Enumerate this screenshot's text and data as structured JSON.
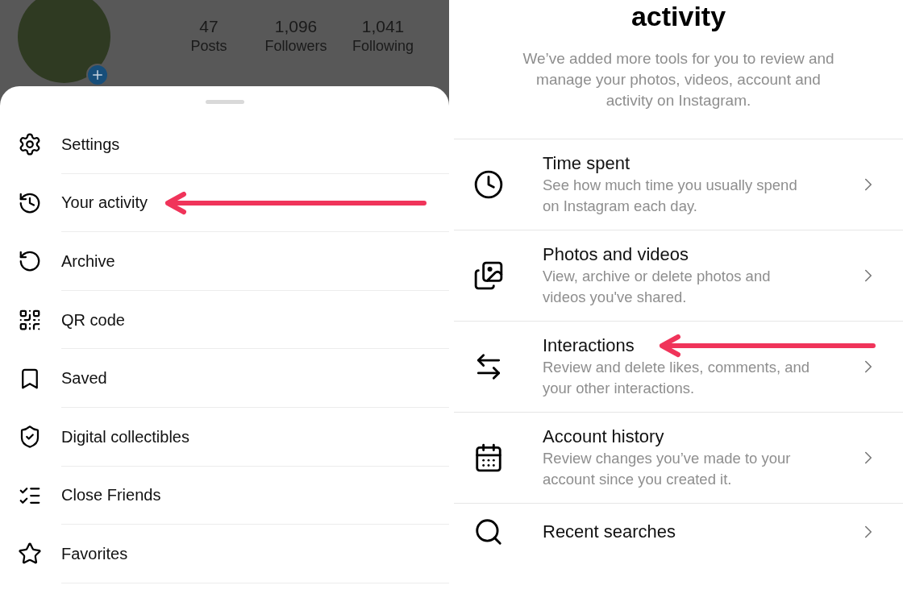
{
  "profile": {
    "stats": [
      {
        "value": "47",
        "label": "Posts"
      },
      {
        "value": "1,096",
        "label": "Followers"
      },
      {
        "value": "1,041",
        "label": "Following"
      }
    ]
  },
  "menu": {
    "items": [
      {
        "label": "Settings",
        "marked": false
      },
      {
        "label": "Your activity",
        "marked": true
      },
      {
        "label": "Archive",
        "marked": false
      },
      {
        "label": "QR code",
        "marked": false
      },
      {
        "label": "Saved",
        "marked": false
      },
      {
        "label": "Digital collectibles",
        "marked": false
      },
      {
        "label": "Close Friends",
        "marked": false
      },
      {
        "label": "Favorites",
        "marked": false
      }
    ]
  },
  "activity": {
    "title": "activity",
    "description": "We’ve added more tools for you to review and manage your photos, videos, account and activity on Instagram.",
    "items": [
      {
        "title": "Time spent",
        "subtitle": "See how much time you usually spend on Instagram each day.",
        "marked": false
      },
      {
        "title": "Photos and videos",
        "subtitle": "View, archive or delete photos and videos you've shared.",
        "marked": false
      },
      {
        "title": "Interactions",
        "subtitle": "Review and delete likes, comments, and your other interactions.",
        "marked": true
      },
      {
        "title": "Account history",
        "subtitle": "Review changes you’ve made to your account since you created it.",
        "marked": false
      },
      {
        "title": "Recent searches",
        "marked": false
      }
    ]
  }
}
